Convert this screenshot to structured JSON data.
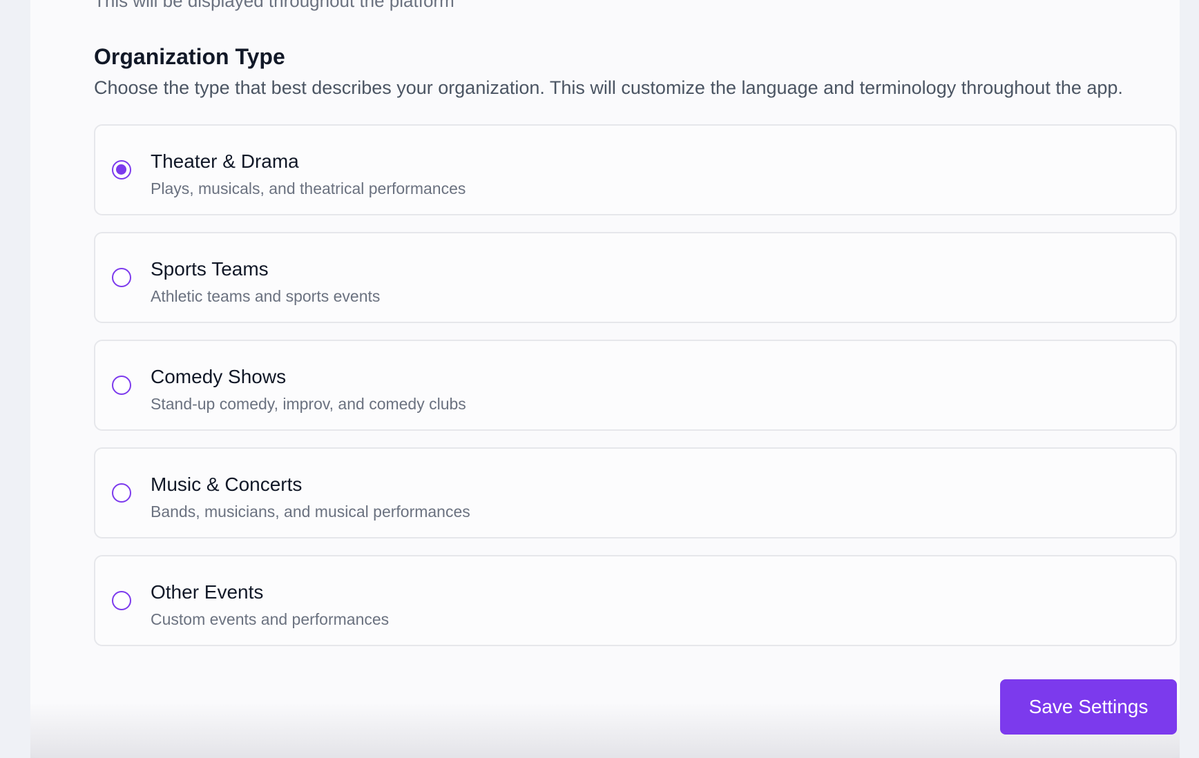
{
  "top_cut_text": "This will be displayed throughout the platform",
  "section": {
    "title": "Organization Type",
    "description": "Choose the type that best describes your organization. This will customize the language and terminology throughout the app."
  },
  "options": [
    {
      "label": "Theater & Drama",
      "description": "Plays, musicals, and theatrical performances",
      "selected": true
    },
    {
      "label": "Sports Teams",
      "description": "Athletic teams and sports events",
      "selected": false
    },
    {
      "label": "Comedy Shows",
      "description": "Stand-up comedy, improv, and comedy clubs",
      "selected": false
    },
    {
      "label": "Music & Concerts",
      "description": "Bands, musicians, and musical performances",
      "selected": false
    },
    {
      "label": "Other Events",
      "description": "Custom events and performances",
      "selected": false
    }
  ],
  "save_button": {
    "label": "Save Settings"
  },
  "colors": {
    "accent": "#7c3aed",
    "page_background": "#eff1f6",
    "card_background": "#fafafc",
    "option_border": "#e6e7eb"
  },
  "icons": {
    "radio_selected": "radio-selected-icon",
    "radio_unselected": "radio-unselected-icon"
  }
}
